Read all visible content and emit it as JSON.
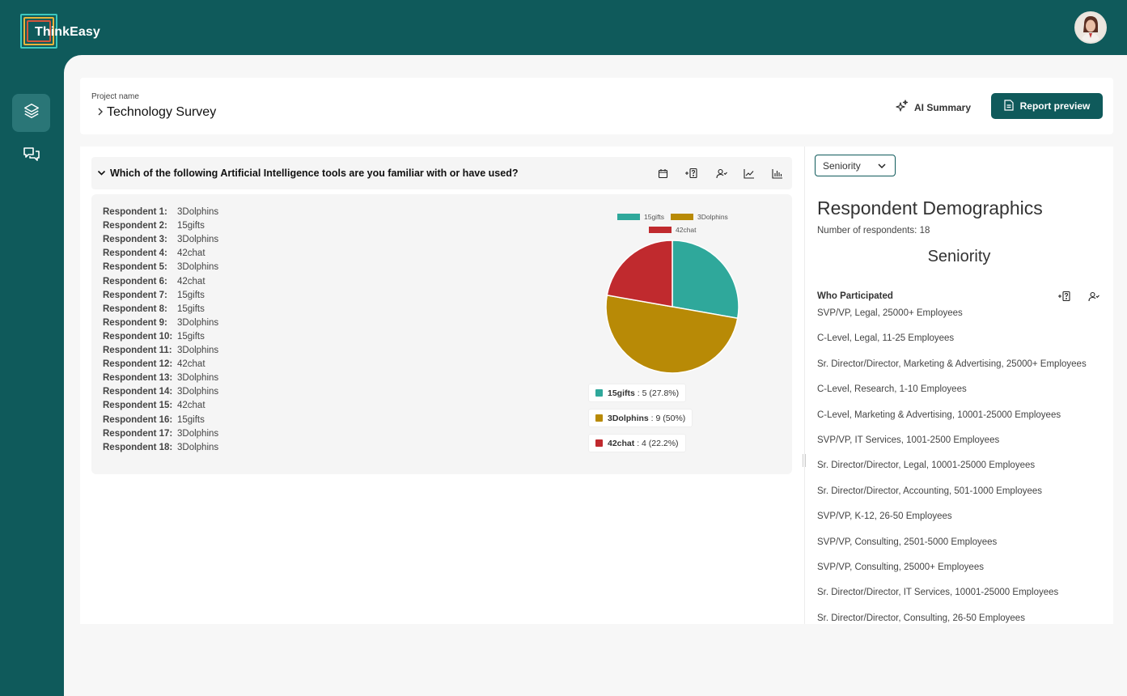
{
  "app": {
    "name": "ThinkEasy"
  },
  "header": {
    "project_label": "Project name",
    "project_name": "Technology Survey",
    "ai_summary_label": "AI Summary",
    "report_preview_label": "Report preview"
  },
  "question": {
    "text": "Which of the following Artificial Intelligence tools are you familiar with or have used?",
    "icons": [
      "calendar-icon",
      "add-question-icon",
      "user-check-icon",
      "line-chart-icon",
      "bar-chart-icon"
    ]
  },
  "responses": [
    {
      "label": "Respondent 1:",
      "value": "3Dolphins"
    },
    {
      "label": "Respondent 2:",
      "value": "15gifts"
    },
    {
      "label": "Respondent 3:",
      "value": "3Dolphins"
    },
    {
      "label": "Respondent 4:",
      "value": "42chat"
    },
    {
      "label": "Respondent 5:",
      "value": "3Dolphins"
    },
    {
      "label": "Respondent 6:",
      "value": "42chat"
    },
    {
      "label": "Respondent 7:",
      "value": "15gifts"
    },
    {
      "label": "Respondent 8:",
      "value": "15gifts"
    },
    {
      "label": "Respondent 9:",
      "value": "3Dolphins"
    },
    {
      "label": "Respondent 10:",
      "value": "15gifts"
    },
    {
      "label": "Respondent 11:",
      "value": "3Dolphins"
    },
    {
      "label": "Respondent 12:",
      "value": "42chat"
    },
    {
      "label": "Respondent 13:",
      "value": "3Dolphins"
    },
    {
      "label": "Respondent 14:",
      "value": "3Dolphins"
    },
    {
      "label": "Respondent 15:",
      "value": "42chat"
    },
    {
      "label": "Respondent 16:",
      "value": "15gifts"
    },
    {
      "label": "Respondent 17:",
      "value": "3Dolphins"
    },
    {
      "label": "Respondent 18:",
      "value": "3Dolphins"
    }
  ],
  "chart_data": {
    "type": "pie",
    "categories": [
      "15gifts",
      "3Dolphins",
      "42chat"
    ],
    "values": [
      5,
      9,
      4
    ],
    "colors": [
      "#2fa89b",
      "#b88a06",
      "#c02a2e"
    ],
    "legend_position": "top",
    "labels": [
      {
        "name": "15gifts",
        "value": " : 5 (27.8%)"
      },
      {
        "name": "3Dolphins",
        "value": " : 9 (50%)"
      },
      {
        "name": "42chat",
        "value": " : 4 (22.2%)"
      }
    ]
  },
  "demographics": {
    "select_value": "Seniority",
    "title": "Respondent Demographics",
    "count_text": "Number of respondents: 18",
    "subtitle": "Seniority",
    "who_label": "Who Participated",
    "participants": [
      "SVP/VP, Legal, 25000+ Employees",
      "C-Level, Legal, 11-25 Employees",
      "Sr. Director/Director, Marketing & Advertising, 25000+ Employees",
      "C-Level, Research, 1-10 Employees",
      "C-Level, Marketing & Advertising, 10001-25000 Employees",
      "SVP/VP, IT Services, 1001-2500 Employees",
      "Sr. Director/Director, Legal, 10001-25000 Employees",
      "Sr. Director/Director, Accounting, 501-1000 Employees",
      "SVP/VP, K-12, 26-50 Employees",
      "SVP/VP, Consulting, 2501-5000 Employees",
      "SVP/VP, Consulting, 25000+ Employees",
      "Sr. Director/Director, IT Services, 10001-25000 Employees",
      "Sr. Director/Director, Consulting, 26-50 Employees"
    ]
  },
  "colors": {
    "brand": "#0f5a5b",
    "accent": "#2a7677"
  }
}
